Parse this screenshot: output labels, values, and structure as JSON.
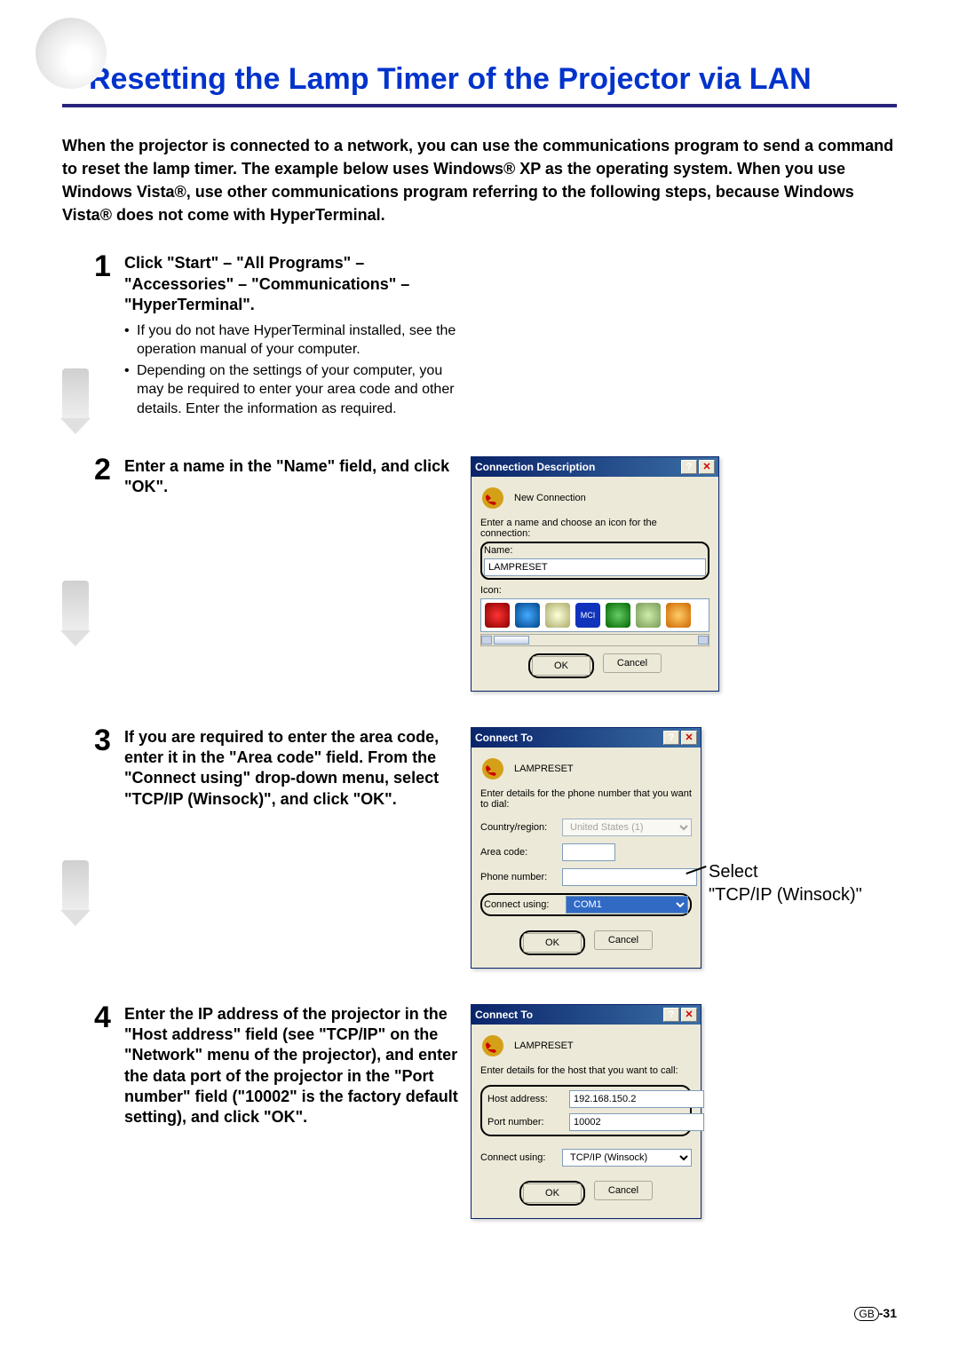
{
  "page": {
    "title": "Resetting the Lamp Timer of the Projector via LAN",
    "intro": "When the projector is connected to a network, you can use the communications program to send a command to reset the lamp timer. The example below uses Windows® XP as the operating system. When you use Windows Vista®, use other communications program referring to the following steps, because Windows Vista® does not come with HyperTerminal.",
    "footer_region": "GB",
    "footer_page": "-31"
  },
  "steps": [
    {
      "num": "1",
      "heading": "Click \"Start\" – \"All Programs\" – \"Accessories\" – \"Communications\" – \"HyperTerminal\".",
      "bullets": [
        "If you do not have HyperTerminal installed, see the operation manual of your computer.",
        "Depending on the settings of your computer, you may be required to enter your area code and other details. Enter the information as required."
      ]
    },
    {
      "num": "2",
      "heading": "Enter a name in the \"Name\" field, and click \"OK\"."
    },
    {
      "num": "3",
      "heading": "If you are required to enter the area code, enter it in the \"Area code\" field. From the \"Connect using\" drop-down menu, select \"TCP/IP (Winsock)\", and click \"OK\"."
    },
    {
      "num": "4",
      "heading": "Enter the IP address of the projector in the \"Host address\" field (see \"TCP/IP\" on the \"Network\" menu of the projector), and enter the data port of the projector  in the \"Port number\" field (\"10002\" is the factory default setting), and click \"OK\"."
    }
  ],
  "dialog1": {
    "title": "Connection Description",
    "subtitle": "New Connection",
    "instruction": "Enter a name and choose an icon for the connection:",
    "name_label": "Name:",
    "name_value": "LAMPRESET",
    "icon_label": "Icon:",
    "ok": "OK",
    "cancel": "Cancel"
  },
  "dialog2": {
    "title": "Connect To",
    "subtitle": "LAMPRESET",
    "instruction": "Enter details for the phone number that you want to dial:",
    "country_label": "Country/region:",
    "country_value": "United States (1)",
    "area_label": "Area code:",
    "area_value": "",
    "phone_label": "Phone number:",
    "phone_value": "",
    "connect_label": "Connect using:",
    "connect_value": "COM1",
    "ok": "OK",
    "cancel": "Cancel",
    "annotation_line1": "Select",
    "annotation_line2": "\"TCP/IP (Winsock)\""
  },
  "dialog3": {
    "title": "Connect To",
    "subtitle": "LAMPRESET",
    "instruction": "Enter details for the host that you want to call:",
    "host_label": "Host address:",
    "host_value": "192.168.150.2",
    "port_label": "Port number:",
    "port_value": "10002",
    "connect_label": "Connect using:",
    "connect_value": "TCP/IP (Winsock)",
    "ok": "OK",
    "cancel": "Cancel"
  }
}
